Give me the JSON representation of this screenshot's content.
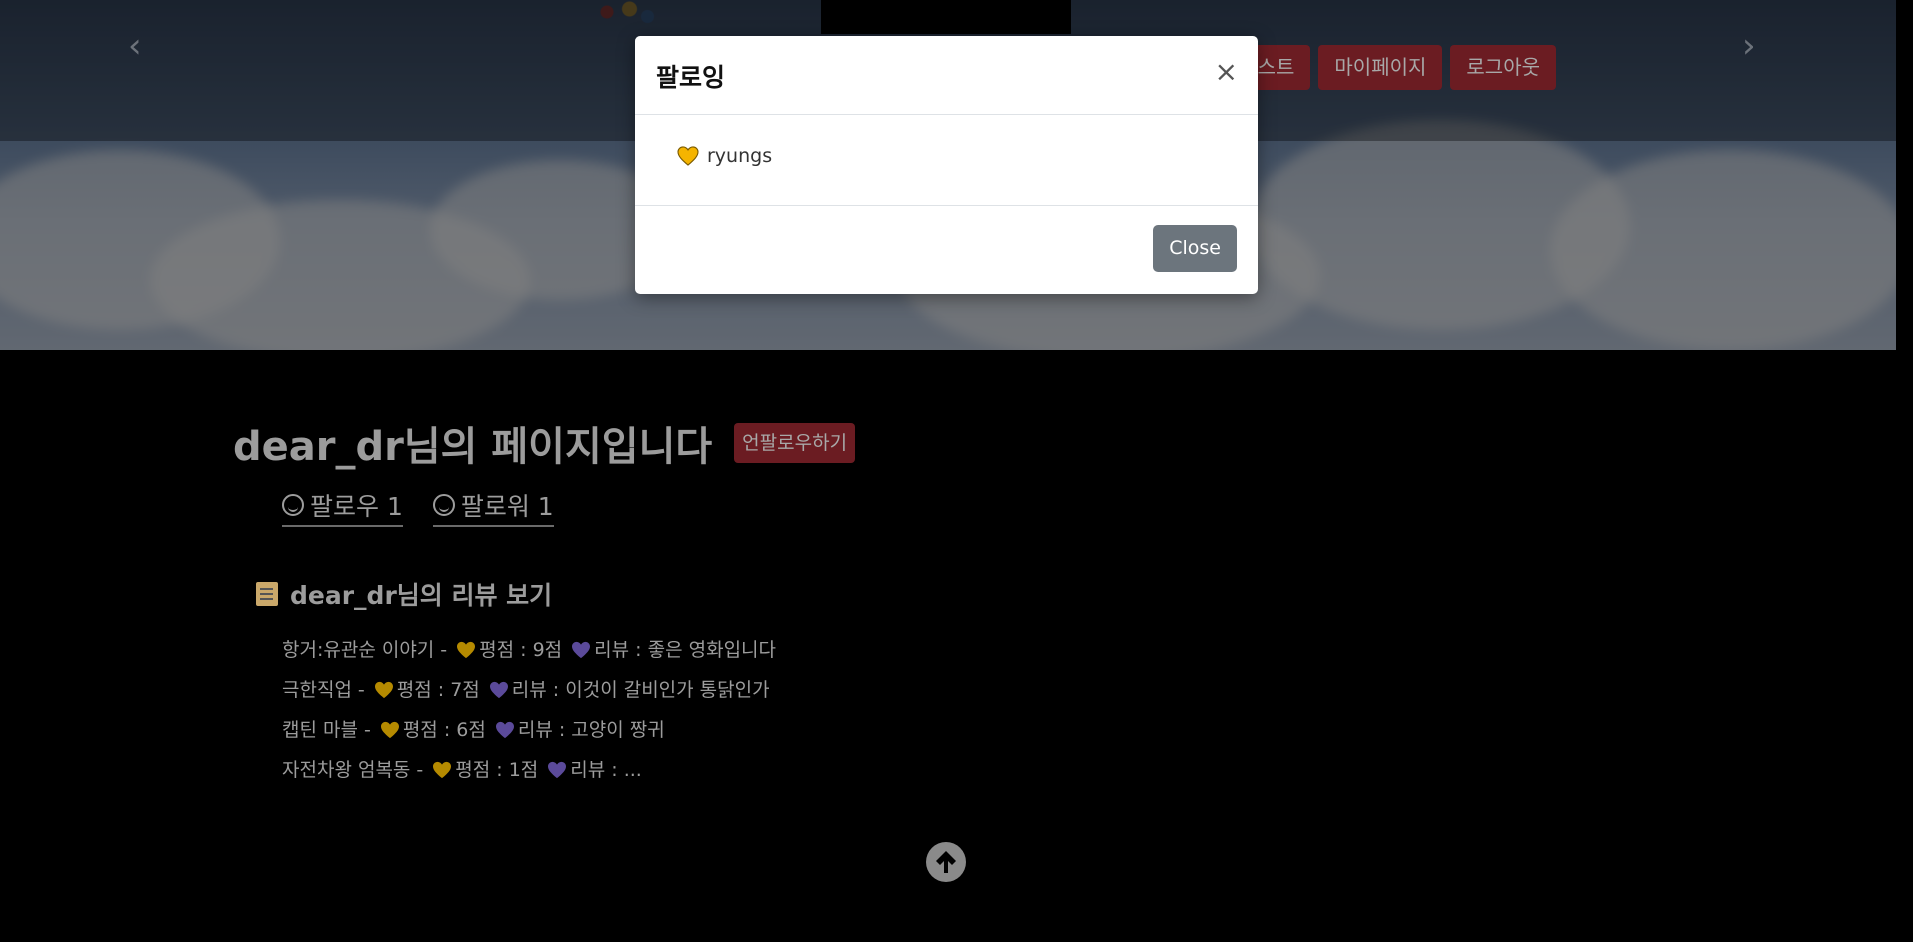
{
  "nav": {
    "user_list": "사용자 리스트",
    "mypage": "마이페이지",
    "logout": "로그아웃"
  },
  "modal": {
    "title": "팔로잉",
    "close_x": "×",
    "items": [
      {
        "name": "ryungs"
      }
    ],
    "close_button": "Close"
  },
  "profile": {
    "title": "dear_dr님의 페이지입니다",
    "unfollow_button": "언팔로우하기",
    "following_label": "팔로우 1",
    "followers_label": "팔로워 1"
  },
  "reviews": {
    "heading": "dear_dr님의 리뷰 보기",
    "items": [
      {
        "movie": "항거:유관순 이야기",
        "rating": "평점 : 9점",
        "review": "리뷰 : 좋은 영화입니다"
      },
      {
        "movie": "극한직업",
        "rating": "평점 : 7점",
        "review": "리뷰 : 이것이 갈비인가 통닭인가"
      },
      {
        "movie": "캡틴 마블",
        "rating": "평점 : 6점",
        "review": "리뷰 : 고양이 짱귀"
      },
      {
        "movie": "자전차왕 엄복동",
        "rating": "평점 : 1점",
        "review": "리뷰 : ..."
      }
    ]
  },
  "colors": {
    "yellow_heart": "#b58a00",
    "purple_heart": "#5b4a9a",
    "modal_heart": "#f5b400"
  }
}
